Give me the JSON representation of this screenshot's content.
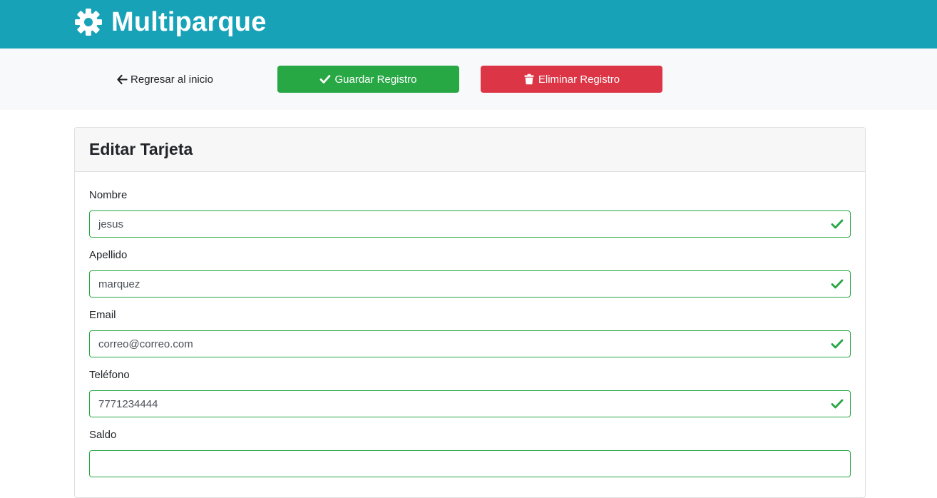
{
  "header": {
    "brand_icon": "gear-icon",
    "brand_name": "Multiparque",
    "color": "#17a2b8"
  },
  "actions": {
    "back_label": "Regresar al inicio",
    "back_icon": "arrow-left-icon",
    "save_label": "Guardar Registro",
    "save_icon": "check-icon",
    "save_color": "#28a745",
    "delete_label": "Eliminar Registro",
    "delete_icon": "trash-icon",
    "delete_color": "#dc3545"
  },
  "card": {
    "title": "Editar Tarjeta",
    "fields": [
      {
        "label": "Nombre",
        "value": "jesus",
        "valid": true
      },
      {
        "label": "Apellido",
        "value": "marquez",
        "valid": true
      },
      {
        "label": "Email",
        "value": "correo@correo.com",
        "valid": true
      },
      {
        "label": "Teléfono",
        "value": "7771234444",
        "valid": true
      },
      {
        "label": "Saldo",
        "value": "",
        "valid": true
      }
    ]
  }
}
